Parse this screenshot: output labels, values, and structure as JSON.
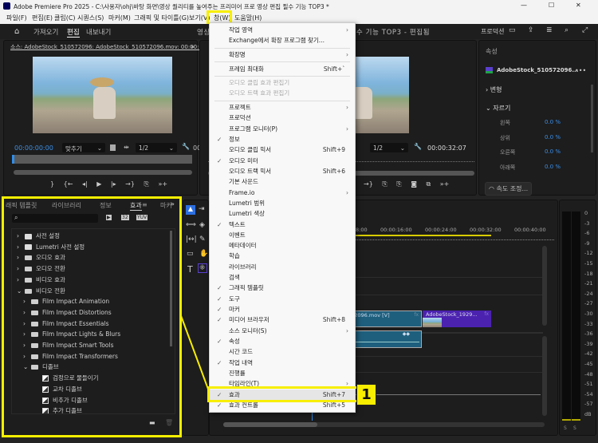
{
  "window": {
    "title": "Adobe Premiere Pro 2025 - C:\\사용자\\ohj\\바탕 화면\\영상 퀄리티를 높여주는 프리미어 프로 영상 편집 필수 기능 TOP3 *",
    "app_icon": "Pr",
    "minimize": "—",
    "maximize": "☐",
    "close": "✕"
  },
  "menubar": [
    {
      "label": "파일(F)"
    },
    {
      "label": "편집(E)"
    },
    {
      "label": "클립(C)"
    },
    {
      "label": "시퀀스(S)"
    },
    {
      "label": "마커(M)"
    },
    {
      "label": "그래픽 및 타이틀(G)"
    },
    {
      "label": "보기(V)"
    },
    {
      "label": "창(W)",
      "active": true
    },
    {
      "label": "도움말(H)"
    }
  ],
  "header": {
    "home_icon": "home-icon",
    "tabs": [
      "가져오기",
      "편집",
      "내보내기"
    ],
    "active_tab": "편집",
    "project_title": "영상 퀄리티를 높여주는 프리미어 프로 영상 편집 필수 기능 TOP3 - 편집됨",
    "workspace": "프로덕션"
  },
  "source_monitor": {
    "tab": "소스: AdobeStock_510572096: AdobeStock_510572096.mov: 00:00:00:00",
    "timecode": "00:00:00:00",
    "fit": "맞추기",
    "resolution": "1/2",
    "timecode_end": "00"
  },
  "program_monitor": {
    "resolution": "1/2",
    "timecode": "00:00:32:07"
  },
  "properties": {
    "title": "속성",
    "clip_name": "AdobeStock_510572096...",
    "more": "•••",
    "transform": "변형",
    "crop": "자르기",
    "crop_rows": [
      {
        "label": "왼쪽",
        "value": "0.0 %"
      },
      {
        "label": "상위",
        "value": "0.0 %"
      },
      {
        "label": "오른쪽",
        "value": "0.0 %"
      },
      {
        "label": "아래쪽",
        "value": "0.0 %"
      }
    ],
    "speed_button": "속도 조정..."
  },
  "effects_panel": {
    "tabs": [
      "래픽 템플릿",
      "라이브러리",
      "정보",
      "효과",
      "마커"
    ],
    "active_tab": "효과",
    "overflow": "»",
    "search_placeholder": "",
    "tree": [
      {
        "label": "사전 설정",
        "level": 0,
        "type": "preset",
        "expanded": false
      },
      {
        "label": "Lumetri 사전 설정",
        "level": 0,
        "type": "preset",
        "expanded": false
      },
      {
        "label": "오디오 효과",
        "level": 0,
        "type": "folder",
        "expanded": false
      },
      {
        "label": "오디오 전환",
        "level": 0,
        "type": "folder",
        "expanded": false
      },
      {
        "label": "비디오 효과",
        "level": 0,
        "type": "folder",
        "expanded": false
      },
      {
        "label": "비디오 전환",
        "level": 0,
        "type": "folder",
        "expanded": true
      },
      {
        "label": "Film Impact Animation",
        "level": 1,
        "type": "folder",
        "expanded": false
      },
      {
        "label": "Film Impact Distortions",
        "level": 1,
        "type": "folder",
        "expanded": false
      },
      {
        "label": "Film Impact Essentials",
        "level": 1,
        "type": "folder",
        "expanded": false
      },
      {
        "label": "Film Impact Lights & Blurs",
        "level": 1,
        "type": "folder",
        "expanded": false
      },
      {
        "label": "Film Impact Smart Tools",
        "level": 1,
        "type": "folder",
        "expanded": false
      },
      {
        "label": "Film Impact Transformers",
        "level": 1,
        "type": "folder",
        "expanded": false
      },
      {
        "label": "디졸브",
        "level": 1,
        "type": "folder",
        "expanded": true
      },
      {
        "label": "검정으로 물들이기",
        "level": 2,
        "type": "effect"
      },
      {
        "label": "교차 디졸브",
        "level": 2,
        "type": "effect"
      },
      {
        "label": "비추가 디졸브",
        "level": 2,
        "type": "effect"
      },
      {
        "label": "추가 디졸브",
        "level": 2,
        "type": "effect"
      }
    ]
  },
  "window_menu": [
    {
      "label": "작업 영역",
      "submenu": true
    },
    {
      "label": "Exchange에서 확장 프로그램 찾기..."
    },
    {
      "sep": true
    },
    {
      "label": "확장명",
      "submenu": true
    },
    {
      "sep": true
    },
    {
      "label": "프레임 최대화",
      "shortcut": "Shift+`"
    },
    {
      "sep": true
    },
    {
      "label": "오디오 클립 효과 편집기",
      "disabled": true
    },
    {
      "label": "오디오 트랙 효과 편집기",
      "disabled": true
    },
    {
      "sep": true
    },
    {
      "label": "프로젝트",
      "submenu": true
    },
    {
      "label": "프로덕션"
    },
    {
      "label": "프로그램 모니터(P)",
      "submenu": true
    },
    {
      "label": "정보",
      "checked": true
    },
    {
      "label": "오디오 클립 믹서",
      "shortcut": "Shift+9"
    },
    {
      "label": "오디오 미터",
      "checked": true
    },
    {
      "label": "오디오 트랙 믹서",
      "shortcut": "Shift+6"
    },
    {
      "label": "기본 사운드"
    },
    {
      "label": "Frame.io",
      "submenu": true
    },
    {
      "label": "Lumetri 범위"
    },
    {
      "label": "Lumetri 색상"
    },
    {
      "label": "텍스트",
      "checked": true
    },
    {
      "label": "이벤트"
    },
    {
      "label": "메타데이터"
    },
    {
      "label": "학습"
    },
    {
      "label": "라이브러리"
    },
    {
      "label": "검색"
    },
    {
      "label": "그래픽 템플릿",
      "checked": true
    },
    {
      "label": "도구",
      "checked": true
    },
    {
      "label": "마커",
      "checked": true
    },
    {
      "label": "미디어 브라우저",
      "checked": true,
      "shortcut": "Shift+8"
    },
    {
      "label": "소스 모니터(S)",
      "submenu": true
    },
    {
      "label": "속성",
      "checked": true
    },
    {
      "label": "시간 코드"
    },
    {
      "label": "작업 내역",
      "checked": true
    },
    {
      "label": "진행률"
    },
    {
      "label": "타임라인(T)",
      "submenu": true
    },
    {
      "label": "효과",
      "checked": true,
      "shortcut": "Shift+7",
      "highlighted": true
    },
    {
      "label": "효과 컨트롤",
      "checked": true,
      "shortcut": "Shift+5"
    }
  ],
  "callout": {
    "number": "1",
    "color": "#f7ee00"
  },
  "timeline": {
    "ruler": [
      "00:00:08:00",
      "00:00:16:00",
      "00:00:24:00",
      "00:00:32:00",
      "00:00:40:00"
    ],
    "clips": [
      {
        "name": "AdobeStock_510572096.mov [V]",
        "label": "572096.mov [V]",
        "track": "V1",
        "color": "#1e5f7e"
      },
      {
        "name": "AdobeStock_1929...",
        "track": "V1",
        "color": "#4b22b0"
      }
    ],
    "fx": "fx"
  },
  "audio_meter": {
    "scale": [
      "0",
      "-3",
      "-6",
      "-9",
      "-12",
      "-15",
      "-18",
      "-21",
      "-24",
      "-27",
      "-30",
      "-33",
      "-36",
      "-39",
      "-42",
      "-45",
      "-48",
      "-51",
      "-54",
      "-57",
      "dB"
    ],
    "solo": [
      "S",
      "S"
    ]
  }
}
